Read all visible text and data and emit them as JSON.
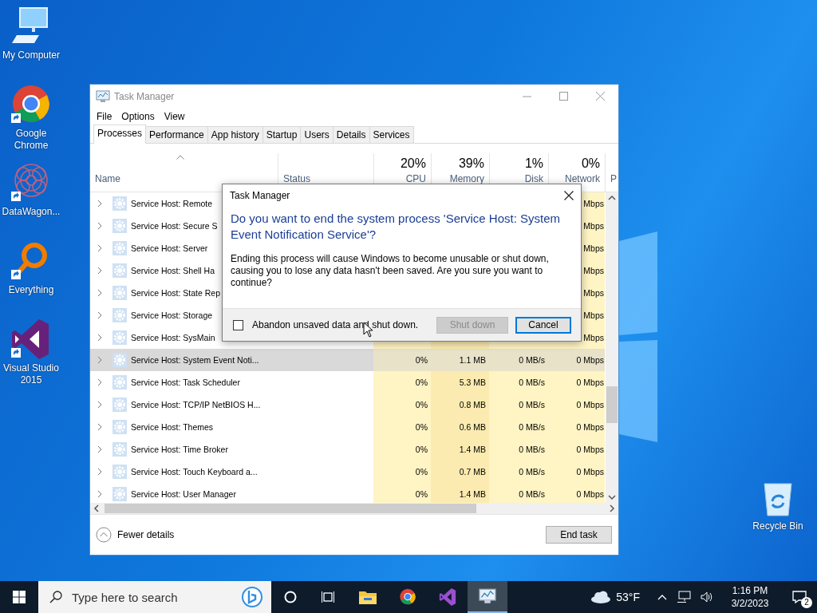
{
  "desktop_icons": [
    {
      "label": "My Computer",
      "kind": "computer"
    },
    {
      "label": "Google Chrome",
      "kind": "chrome"
    },
    {
      "label": "DataWagon...",
      "kind": "datawagon"
    },
    {
      "label": "Everything",
      "kind": "everything"
    },
    {
      "label": "Visual Studio 2015",
      "kind": "visualstudio"
    }
  ],
  "recycle_bin": {
    "label": "Recycle Bin"
  },
  "window": {
    "title": "Task Manager",
    "menu": [
      "File",
      "Options",
      "View"
    ],
    "tabs": [
      {
        "label": "Processes",
        "selected": true
      },
      {
        "label": "Performance",
        "selected": false
      },
      {
        "label": "App history",
        "selected": false
      },
      {
        "label": "Startup",
        "selected": false
      },
      {
        "label": "Users",
        "selected": false
      },
      {
        "label": "Details",
        "selected": false
      },
      {
        "label": "Services",
        "selected": false
      }
    ],
    "columns": [
      {
        "label": "Name"
      },
      {
        "label": "Status"
      },
      {
        "label": "CPU",
        "summary": "20%"
      },
      {
        "label": "Memory",
        "summary": "39%"
      },
      {
        "label": "Disk",
        "summary": "1%"
      },
      {
        "label": "Network",
        "summary": "0%"
      },
      {
        "label": "P"
      }
    ],
    "rows": [
      {
        "name": "Service Host: Remote",
        "network": "Mbps",
        "selected": false
      },
      {
        "name": "Service Host: Secure S",
        "network": "Mbps",
        "selected": false
      },
      {
        "name": "Service Host: Server",
        "network": "Mbps",
        "selected": false
      },
      {
        "name": "Service Host: Shell Ha",
        "network": "Mbps",
        "selected": false
      },
      {
        "name": "Service Host: State Rep",
        "network": "Mbps",
        "selected": false
      },
      {
        "name": "Service Host: Storage",
        "network": "Mbps",
        "selected": false
      },
      {
        "name": "Service Host: SysMain",
        "network": "Mbps",
        "selected": false
      },
      {
        "name": "Service Host: System Event Noti...",
        "cpu": "0%",
        "memory": "1.1 MB",
        "disk": "0 MB/s",
        "network": "0 Mbps",
        "selected": true
      },
      {
        "name": "Service Host: Task Scheduler",
        "cpu": "0%",
        "memory": "5.3 MB",
        "disk": "0 MB/s",
        "network": "0 Mbps",
        "selected": false
      },
      {
        "name": "Service Host: TCP/IP NetBIOS H...",
        "cpu": "0%",
        "memory": "0.8 MB",
        "disk": "0 MB/s",
        "network": "0 Mbps",
        "selected": false
      },
      {
        "name": "Service Host: Themes",
        "cpu": "0%",
        "memory": "0.6 MB",
        "disk": "0 MB/s",
        "network": "0 Mbps",
        "selected": false
      },
      {
        "name": "Service Host: Time Broker",
        "cpu": "0%",
        "memory": "1.4 MB",
        "disk": "0 MB/s",
        "network": "0 Mbps",
        "selected": false
      },
      {
        "name": "Service Host: Touch Keyboard a...",
        "cpu": "0%",
        "memory": "0.7 MB",
        "disk": "0 MB/s",
        "network": "0 Mbps",
        "selected": false
      },
      {
        "name": "Service Host: User Manager",
        "cpu": "0%",
        "memory": "1.4 MB",
        "disk": "0 MB/s",
        "network": "0 Mbps",
        "selected": false
      }
    ],
    "footer": {
      "toggle_label": "Fewer details",
      "end_task": "End task"
    }
  },
  "dialog": {
    "title": "Task Manager",
    "heading": "Do you want to end the system process 'Service Host: System Event Notification Service'?",
    "message": "Ending this process will cause Windows to become unusable or shut down, causing you to lose any data hasn't been saved. Are you sure you want to continue?",
    "checkbox": {
      "label": "Abandon unsaved data and shut down.",
      "checked": false
    },
    "buttons": [
      {
        "label": "Shut down",
        "disabled": true,
        "focused": false
      },
      {
        "label": "Cancel",
        "disabled": false,
        "focused": true
      }
    ]
  },
  "taskbar": {
    "search_placeholder": "Type here to search",
    "apps": [
      {
        "kind": "explorer",
        "active": false
      },
      {
        "kind": "chrome",
        "active": false
      },
      {
        "kind": "visualstudio",
        "active": false
      },
      {
        "kind": "taskmanager",
        "active": true
      }
    ],
    "weather": "53°F",
    "time": "1:16 PM",
    "date": "3/2/2023",
    "notification_count": "2"
  }
}
